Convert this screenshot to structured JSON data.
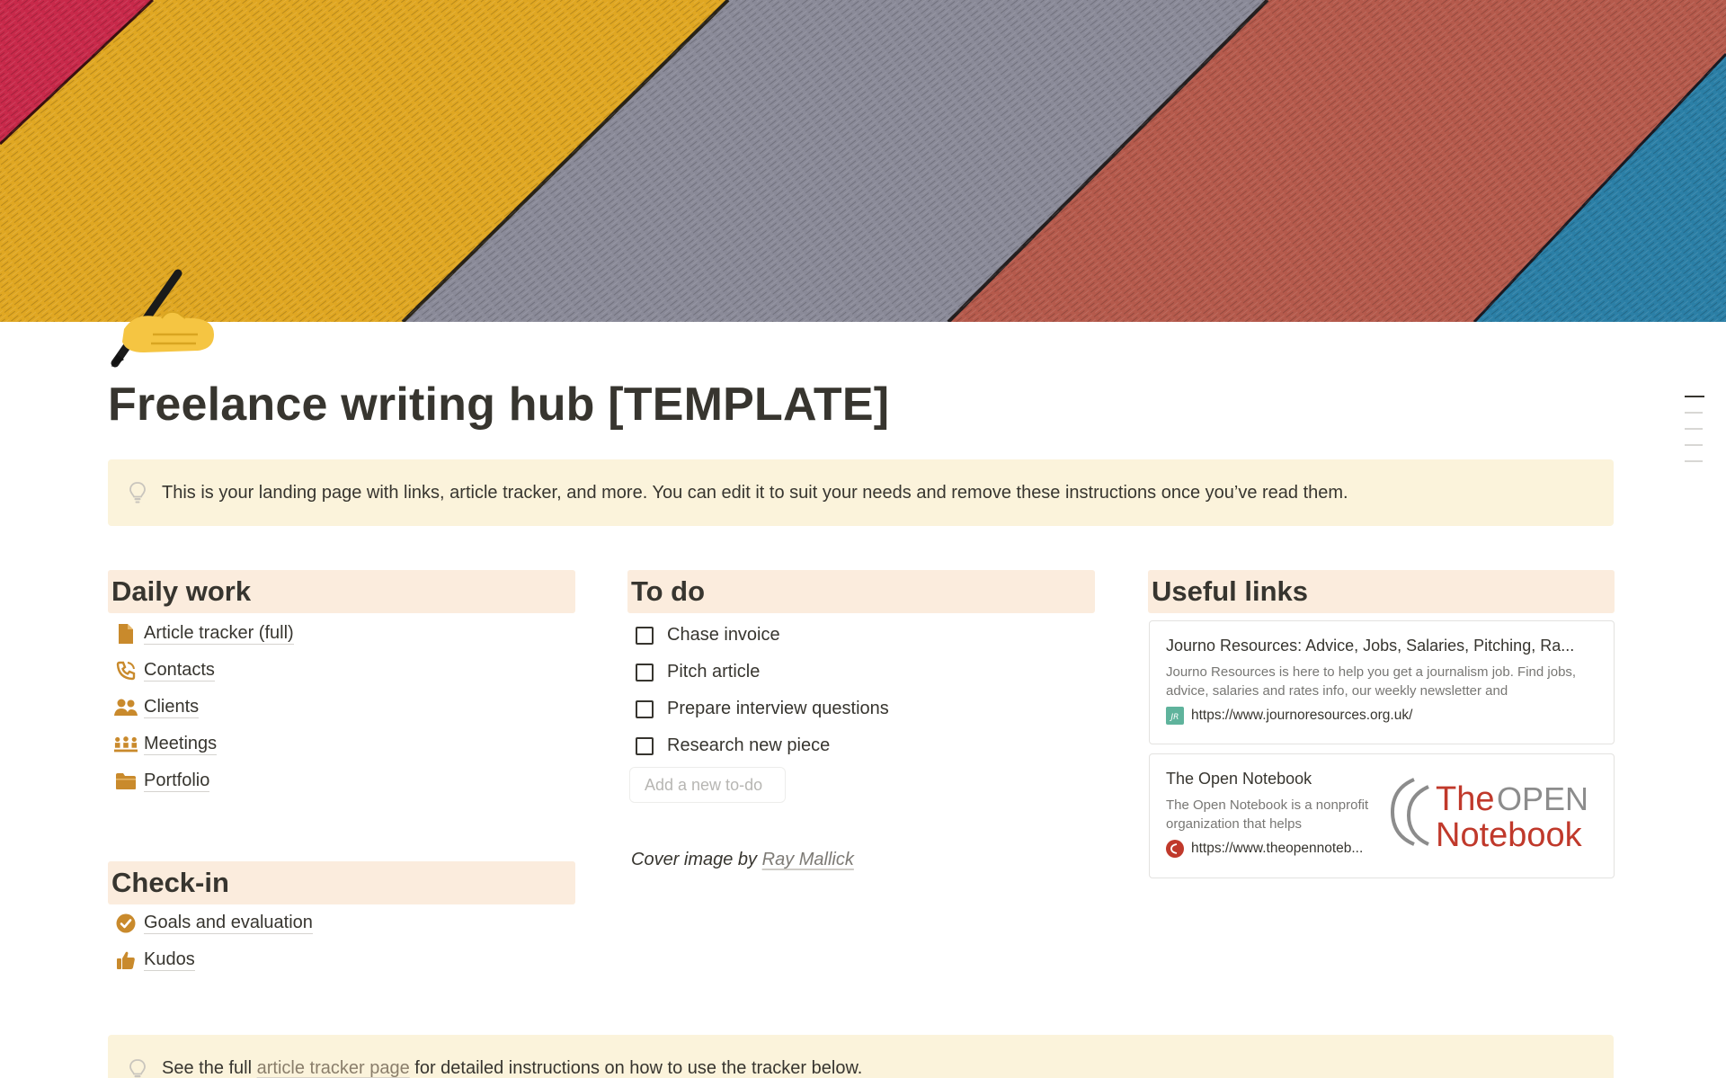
{
  "page": {
    "title": "Freelance writing hub [TEMPLATE]",
    "icon": "writing-hand-emoji"
  },
  "callout_top": {
    "icon": "lightbulb-icon",
    "text": "This is your landing page with links, article tracker, and more. You can edit it to suit your needs and remove these instructions once you’ve read them."
  },
  "daily_work": {
    "heading": "Daily work",
    "items": [
      {
        "label": "Article tracker (full)",
        "icon": "document-icon"
      },
      {
        "label": "Contacts",
        "icon": "phone-icon"
      },
      {
        "label": "Clients",
        "icon": "people-icon"
      },
      {
        "label": "Meetings",
        "icon": "group-icon"
      },
      {
        "label": "Portfolio",
        "icon": "folder-icon"
      }
    ]
  },
  "check_in": {
    "heading": "Check-in",
    "items": [
      {
        "label": "Goals and evaluation",
        "icon": "check-circle-icon"
      },
      {
        "label": "Kudos",
        "icon": "thumbs-up-icon"
      }
    ]
  },
  "todo": {
    "heading": "To do",
    "items": [
      {
        "label": "Chase invoice",
        "checked": false
      },
      {
        "label": "Pitch article",
        "checked": false
      },
      {
        "label": "Prepare interview questions",
        "checked": false
      },
      {
        "label": "Research new piece",
        "checked": false
      }
    ],
    "add_placeholder": "Add a new to-do"
  },
  "cover_credit": {
    "prefix": "Cover image by",
    "author": "Ray Mallick"
  },
  "useful_links": {
    "heading": "Useful links",
    "bookmarks": [
      {
        "title": "Journo Resources: Advice, Jobs, Salaries, Pitching, Ra...",
        "description": "Journo Resources is here to help you get a journalism job. Find jobs, advice, salaries and rates info, our weekly newsletter and",
        "url": "https://www.journoresources.org.uk/",
        "favicon": "JR"
      },
      {
        "title": "The Open Notebook",
        "description": "The Open Notebook is a nonprofit organization that helps",
        "url": "https://www.theopennoteb...",
        "logo_line1_a": "The",
        "logo_line1_b": "OPEN",
        "logo_line2": "Notebook"
      }
    ]
  },
  "callout_bottom": {
    "prefix": "See the full",
    "link": "article tracker page",
    "suffix": "for detailed instructions on how to use the tracker below."
  },
  "colors": {
    "accent_icon": "#c98a2c",
    "callout_bg": "#fbf3db",
    "heading_bg": "#fbecdd"
  }
}
